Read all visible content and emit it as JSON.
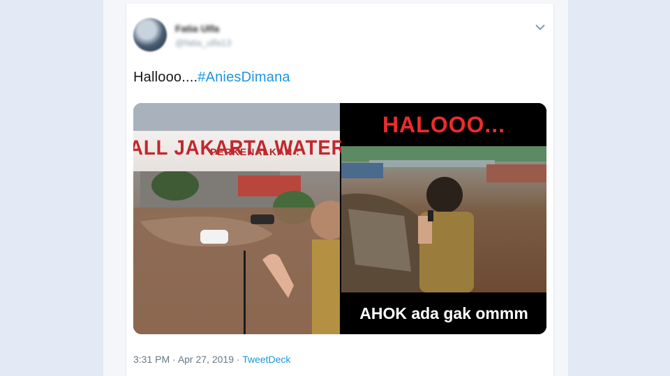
{
  "tweet": {
    "user_name": "Fatia Ulfa",
    "user_handle": "@fatia_ulfa13",
    "text_prefix": "Hallooo....",
    "hashtag": "#AniesDimana",
    "time": "3:31 PM",
    "separator1": " · ",
    "date": "Apr 27, 2019",
    "separator2": " · ",
    "source": "TweetDeck"
  },
  "media": {
    "left_sign_small": "PERKENALKAN :",
    "left_sign_big": "ALL JAKARTA WATER F",
    "right_top": "HALOOO...",
    "right_bottom": "AHOK ada gak ommm"
  },
  "icons": {
    "caret": "chevron-down-icon"
  },
  "colors": {
    "link": "#1b95e0",
    "halo_red": "#ee2b2b",
    "sign_red": "#c1272d"
  }
}
